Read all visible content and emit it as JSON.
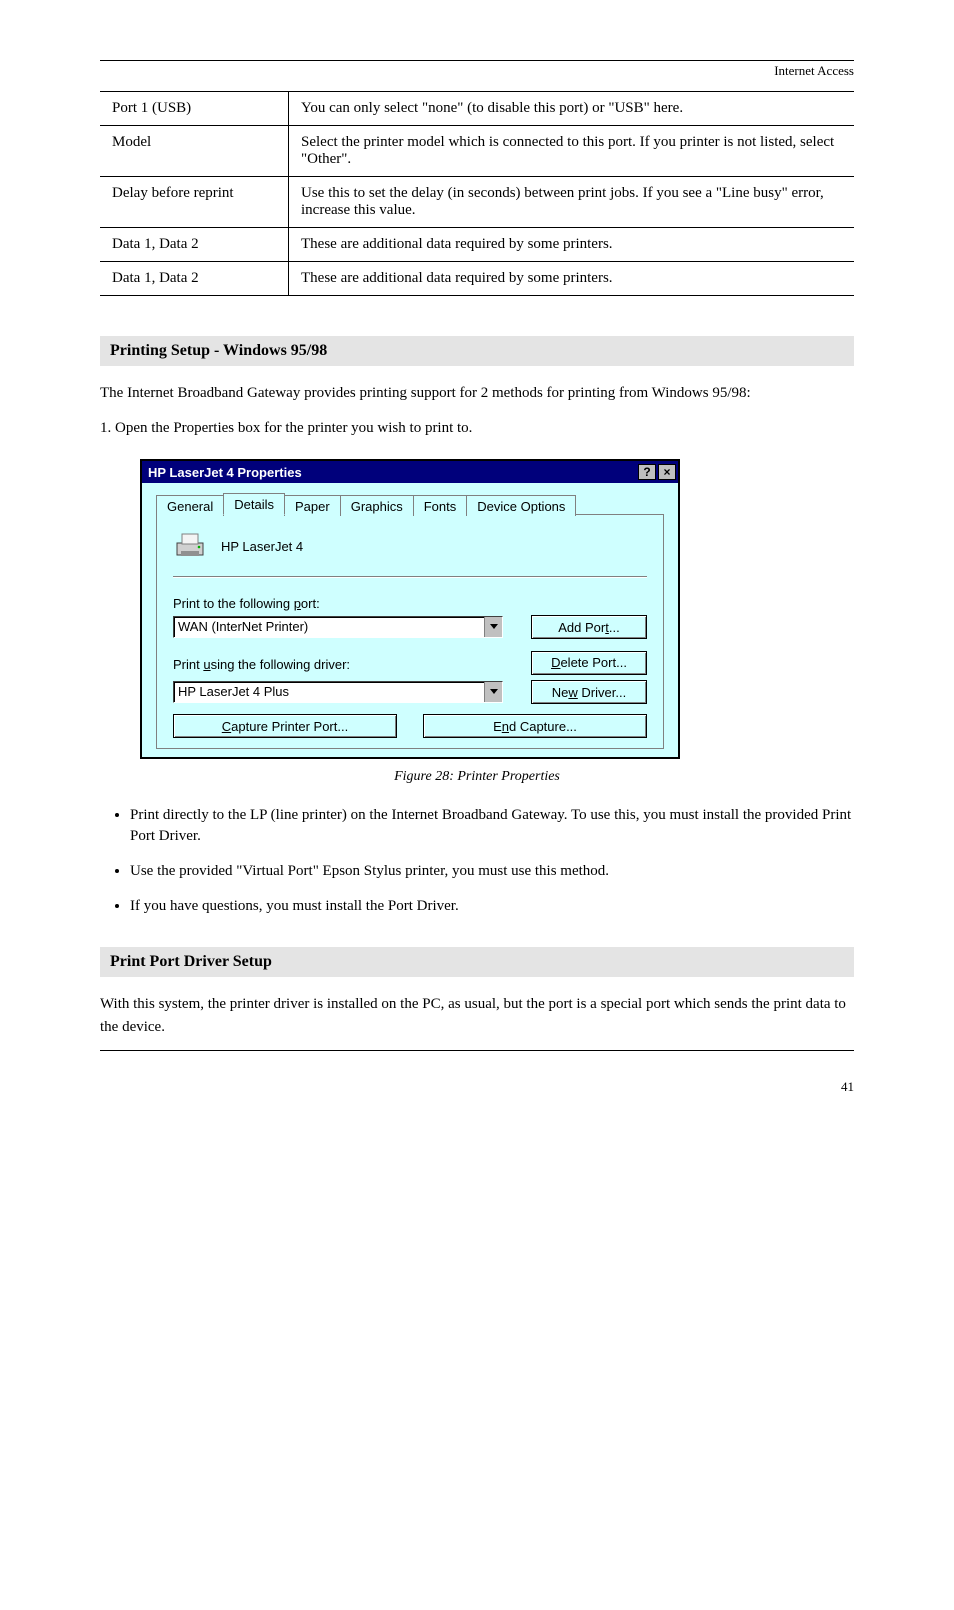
{
  "header_right": "Internet Access",
  "table": {
    "rows": [
      {
        "left": "Port 1 (USB)",
        "right": "You can only select \"none\" (to disable this port) or \"USB\" here."
      },
      {
        "left": "Model",
        "right": "Select the printer model which is connected to this port. If you printer is not listed, select \"Other\"."
      },
      {
        "left": "Delay before reprint",
        "right": "Use this to set the delay (in seconds) between print jobs. If you see a \"Line busy\" error, increase this value."
      },
      {
        "left": "Data 1, Data 2",
        "right": "These are additional data required by some printers."
      },
      {
        "left": "Data 1, Data 2",
        "right": "These are additional data required by some printers."
      }
    ]
  },
  "section1_title": "Printing Setup - Windows 95/98",
  "section1_p1": "The Internet Broadband Gateway provides printing support for 2 methods for printing from Windows 95/98:",
  "section1_step1": "1. Open the Properties box for the printer you wish to print to.",
  "dialog": {
    "title": "HP LaserJet 4 Properties",
    "tabs": [
      "General",
      "Details",
      "Paper",
      "Graphics",
      "Fonts",
      "Device Options"
    ],
    "active_tab": 1,
    "printer_name": "HP LaserJet 4",
    "port_label_pre": "Print to the following ",
    "port_label_accel": "p",
    "port_label_post": "ort:",
    "port_value": "WAN  (InterNet Printer)",
    "driver_label_pre": "Print ",
    "driver_label_accel": "u",
    "driver_label_post": "sing the following driver:",
    "driver_value": "HP LaserJet 4 Plus",
    "btn_add_port": "Add Por",
    "btn_add_port_accel": "t",
    "btn_add_port_post": "...",
    "btn_delete_port_accel": "D",
    "btn_delete_port": "elete Port...",
    "btn_new_driver": "Ne",
    "btn_new_driver_accel": "w",
    "btn_new_driver_post": " Driver...",
    "btn_capture_accel": "C",
    "btn_capture": "apture Printer Port...",
    "btn_end_pre": "E",
    "btn_end_accel": "n",
    "btn_end_post": "d Capture..."
  },
  "fig_caption": "Figure 28: Printer Properties",
  "bullets": [
    "Print directly to the LP (line printer) on the Internet Broadband Gateway. To use this, you must install the provided Print Port Driver.",
    "Use the provided \"Virtual Port\" Epson Stylus printer, you must use this method.",
    "If you have questions, you must install the Port Driver."
  ],
  "section2_title": "Print Port Driver Setup",
  "section2_p1": "With this system, the printer driver is installed on the PC, as usual, but the port is a special port which sends the print data to the device.",
  "footer_page": "41"
}
